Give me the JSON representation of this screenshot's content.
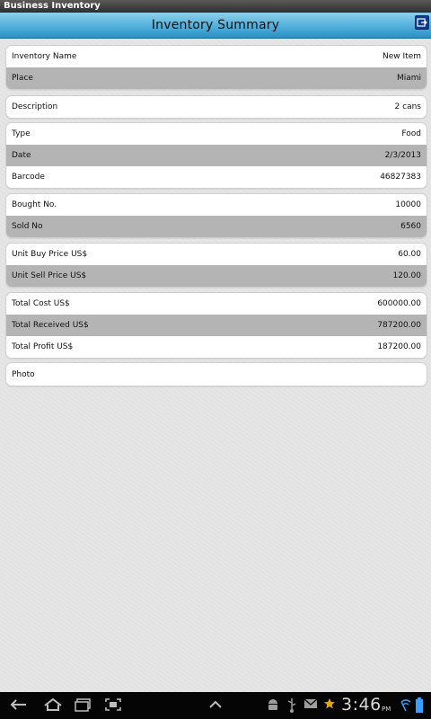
{
  "app": {
    "title": "Business Inventory"
  },
  "header": {
    "title": "Inventory Summary"
  },
  "groups": [
    {
      "rows": [
        {
          "label": "Inventory Name",
          "value": "New Item"
        },
        {
          "label": "Place",
          "value": "Miami"
        }
      ]
    },
    {
      "rows": [
        {
          "label": "Description",
          "value": "2  cans"
        }
      ]
    },
    {
      "rows": [
        {
          "label": "Type",
          "value": "Food"
        },
        {
          "label": "Date",
          "value": "2/3/2013"
        },
        {
          "label": "Barcode",
          "value": "46827383"
        }
      ]
    },
    {
      "rows": [
        {
          "label": "Bought No.",
          "value": "10000"
        },
        {
          "label": "Sold No",
          "value": "6560"
        }
      ]
    },
    {
      "rows": [
        {
          "label": "Unit Buy Price US$",
          "value": "60.00"
        },
        {
          "label": "Unit Sell Price US$",
          "value": "120.00"
        }
      ]
    },
    {
      "rows": [
        {
          "label": "Total Cost US$",
          "value": "600000.00"
        },
        {
          "label": "Total Received US$",
          "value": "787200.00"
        },
        {
          "label": "Total Profit US$",
          "value": "187200.00"
        }
      ]
    },
    {
      "rows": [
        {
          "label": "Photo",
          "value": ""
        }
      ]
    }
  ],
  "system_bar": {
    "time": "3:46",
    "ampm": "PM",
    "icons": [
      "back-icon",
      "home-icon",
      "recent-apps-icon",
      "screenshot-icon",
      "up-chevron-icon",
      "android-icon",
      "usb-icon",
      "gmail-icon",
      "star-icon",
      "wifi-icon",
      "battery-icon"
    ]
  }
}
